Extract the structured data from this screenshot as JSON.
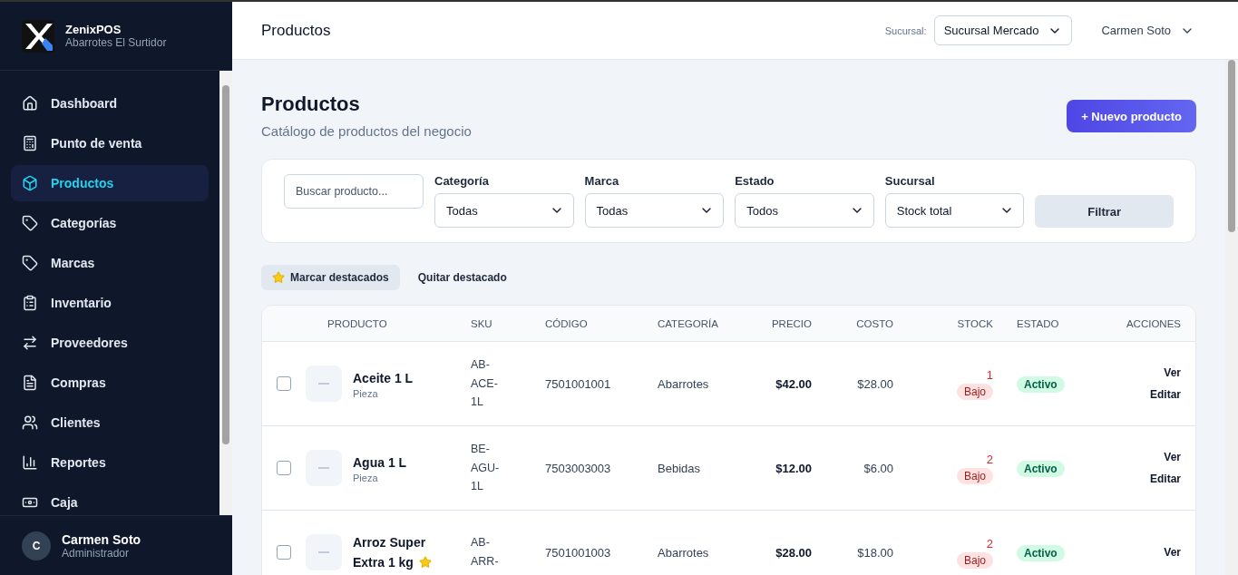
{
  "brand": {
    "name": "ZenixPOS",
    "subtitle": "Abarrotes El Surtidor"
  },
  "sidebar": {
    "items": [
      {
        "label": "Dashboard",
        "selected": false
      },
      {
        "label": "Punto de venta",
        "selected": false
      },
      {
        "label": "Productos",
        "selected": true
      },
      {
        "label": "Categorías",
        "selected": false
      },
      {
        "label": "Marcas",
        "selected": false
      },
      {
        "label": "Inventario",
        "selected": false
      },
      {
        "label": "Proveedores",
        "selected": false
      },
      {
        "label": "Compras",
        "selected": false
      },
      {
        "label": "Clientes",
        "selected": false
      },
      {
        "label": "Reportes",
        "selected": false
      },
      {
        "label": "Caja",
        "selected": false
      }
    ],
    "user": {
      "initial": "C",
      "name": "Carmen Soto",
      "role": "Administrador"
    }
  },
  "topbar": {
    "title": "Productos",
    "branch_label": "Sucursal:",
    "branch": "Sucursal Mercado",
    "user": "Carmen Soto"
  },
  "page": {
    "title": "Productos",
    "subtitle": "Catálogo de productos del negocio",
    "new_button": "+ Nuevo producto"
  },
  "filters": {
    "search": {
      "placeholder": "Buscar producto..."
    },
    "selects": [
      {
        "label": "Categoría",
        "value": "Todas"
      },
      {
        "label": "Marca",
        "value": "Todas"
      },
      {
        "label": "Estado",
        "value": "Todos"
      },
      {
        "label": "Sucursal",
        "value": "Stock total"
      }
    ],
    "button": "Filtrar"
  },
  "bulk_actions": [
    {
      "label": "Marcar destacados",
      "kind": "star"
    },
    {
      "label": "Quitar destacado",
      "kind": "plain"
    }
  ],
  "table": {
    "columns": [
      "PRODUCTO",
      "SKU",
      "CÓDIGO",
      "CATEGORÍA",
      "PRECIO",
      "COSTO",
      "STOCK",
      "ESTADO",
      "ACCIONES"
    ],
    "rows": [
      {
        "checked": false,
        "name": "Aceite 1 L",
        "unit": "Pieza",
        "featured": false,
        "sku": "AB-ACE-1L",
        "code": "7501001001",
        "category": "Abarrotes",
        "price": "$42.00",
        "cost": "$28.00",
        "stock": "1",
        "stock_badge": "Bajo",
        "status": "Activo",
        "actions": [
          "Ver",
          "Editar"
        ]
      },
      {
        "checked": false,
        "name": "Agua 1 L",
        "unit": "Pieza",
        "featured": false,
        "sku": "BE-AGU-1L",
        "code": "7503003003",
        "category": "Bebidas",
        "price": "$12.00",
        "cost": "$6.00",
        "stock": "2",
        "stock_badge": "Bajo",
        "status": "Activo",
        "actions": [
          "Ver",
          "Editar"
        ]
      },
      {
        "checked": false,
        "name": "Arroz Super Extra 1 kg",
        "featured": true,
        "sku": "AB-ARR-",
        "code": "7501001003",
        "category": "Abarrotes",
        "price": "$28.00",
        "cost": "$18.00",
        "stock": "2",
        "stock_badge": "Bajo",
        "status": "Activo",
        "actions": [
          "Ver"
        ]
      }
    ]
  }
}
